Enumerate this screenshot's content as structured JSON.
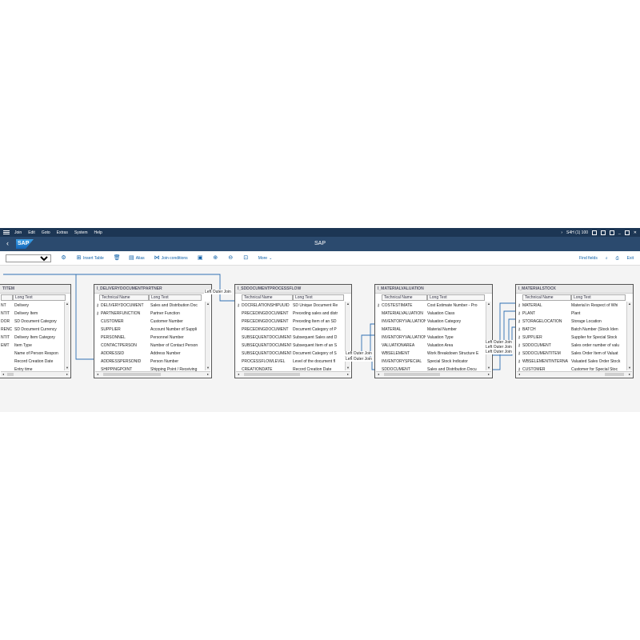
{
  "menubar": {
    "items": [
      "Join",
      "Edit",
      "Goto",
      "Extras",
      "System",
      "Help"
    ],
    "system_info": "S4H (1) 100"
  },
  "shell": {
    "logo": "SAP",
    "title": "SAP"
  },
  "toolbar": {
    "insert_table": "Insert Table",
    "alias": "Alias",
    "join_conditions": "Join conditions",
    "more": "More",
    "find_fields": "Find fields",
    "exit": "Exit"
  },
  "columns": {
    "technical_name": "Technical Name",
    "long_text": "Long Text"
  },
  "tables": [
    {
      "name": "TITEM",
      "rows": [
        {
          "key": false,
          "tech": "NT",
          "text": "Delivery"
        },
        {
          "key": false,
          "tech": "NTIT",
          "text": "Delivery Item"
        },
        {
          "key": false,
          "tech": "DOR",
          "text": "SD Document Category"
        },
        {
          "key": false,
          "tech": "RENC",
          "text": "SD Document Currency"
        },
        {
          "key": false,
          "tech": "NTIT",
          "text": "Delivery Item Category"
        },
        {
          "key": false,
          "tech": "EMT",
          "text": "Item Type"
        },
        {
          "key": false,
          "tech": "",
          "text": "Name of Person Respon"
        },
        {
          "key": false,
          "tech": "",
          "text": "Record Creation Date"
        },
        {
          "key": false,
          "tech": "",
          "text": "Entry time"
        }
      ]
    },
    {
      "name": "I_DELIVERYDOCUMENTPARTNER",
      "rows": [
        {
          "key": true,
          "tech": "DELIVERYDOCUMENT",
          "text": "Sales and Distribution Doc"
        },
        {
          "key": true,
          "tech": "PARTNERFUNCTION",
          "text": "Partner Function"
        },
        {
          "key": false,
          "tech": "CUSTOMER",
          "text": "Customer Number"
        },
        {
          "key": false,
          "tech": "SUPPLIER",
          "text": "Account Number of Suppli"
        },
        {
          "key": false,
          "tech": "PERSONNEL",
          "text": "Personnel Number"
        },
        {
          "key": false,
          "tech": "CONTACTPERSON",
          "text": "Number of Contact Person"
        },
        {
          "key": false,
          "tech": "ADDRESSID",
          "text": "Address Number"
        },
        {
          "key": false,
          "tech": "ADDRESSPERSONID",
          "text": "Person Number"
        },
        {
          "key": false,
          "tech": "SHIPPINGPOINT",
          "text": "Shipping Point / Receiving"
        }
      ]
    },
    {
      "name": "I_SDDOCUMENTPROCESSFLOW",
      "rows": [
        {
          "key": true,
          "tech": "DOCRELATIONSHIPUUID",
          "text": "SD Unique Document Re"
        },
        {
          "key": false,
          "tech": "PRECEDINGDOCUMENT",
          "text": "Preceding sales and distr"
        },
        {
          "key": false,
          "tech": "PRECEDINGDOCUMENT",
          "text": "Preceding Item of an SD"
        },
        {
          "key": false,
          "tech": "PRECEDINGDOCUMENT",
          "text": "Document Category of P"
        },
        {
          "key": false,
          "tech": "SUBSEQUENTDOCUMENT",
          "text": "Subsequent Sales and D"
        },
        {
          "key": false,
          "tech": "SUBSEQUENTDOCUMENT",
          "text": "Subsequent Item of an S"
        },
        {
          "key": false,
          "tech": "SUBSEQUENTDOCUMENT",
          "text": "Document Category of S"
        },
        {
          "key": false,
          "tech": "PROCESSFLOWLEVEL",
          "text": "Level of the document fl"
        },
        {
          "key": false,
          "tech": "CREATIONDATE",
          "text": "Record Creation Date"
        }
      ]
    },
    {
      "name": "I_MATERIALVALUATION",
      "rows": [
        {
          "key": true,
          "tech": "COSTESTIMATE",
          "text": "Cost Estimate Number - Pro"
        },
        {
          "key": false,
          "tech": "MATERIALVALUATION",
          "text": "Valuation Class"
        },
        {
          "key": false,
          "tech": "INVENTORYVALUATION",
          "text": "Valuation Category"
        },
        {
          "key": false,
          "tech": "MATERIAL",
          "text": "Material Number"
        },
        {
          "key": false,
          "tech": "INVENTORYVALUATION",
          "text": "Valuation Type"
        },
        {
          "key": false,
          "tech": "VALUATIONAREA",
          "text": "Valuation Area"
        },
        {
          "key": false,
          "tech": "WBSELEMENT",
          "text": "Work Breakdown Structure E"
        },
        {
          "key": false,
          "tech": "INVENTORYSPECIAL",
          "text": "Special Stock Indicator"
        },
        {
          "key": false,
          "tech": "SDDOCUMENT",
          "text": "Sales and Distribution Docu"
        }
      ]
    },
    {
      "name": "I_MATERIALSTOCK",
      "rows": [
        {
          "key": true,
          "tech": "MATERIAL",
          "text": "Material in Respect of Whi"
        },
        {
          "key": true,
          "tech": "PLANT",
          "text": "Plant"
        },
        {
          "key": true,
          "tech": "STORAGELOCATION",
          "text": "Storage Location"
        },
        {
          "key": true,
          "tech": "BATCH",
          "text": "Batch Number (Stock Iden"
        },
        {
          "key": true,
          "tech": "SUPPLIER",
          "text": "Supplier for Special Stock"
        },
        {
          "key": true,
          "tech": "SDDOCUMENT",
          "text": "Sales order number of valu"
        },
        {
          "key": true,
          "tech": "SDDOCUMENTITEM",
          "text": "Sales Order Item of Valuat"
        },
        {
          "key": true,
          "tech": "WBSELEMENTINTERNA",
          "text": "Valuated Sales Order Stock"
        },
        {
          "key": true,
          "tech": "CUSTOMER",
          "text": "Customer for Special Stoc"
        }
      ]
    }
  ],
  "joins": {
    "j1": "Left Outer Join",
    "j2": "Left Outer Join",
    "j3": "Left Outer Join",
    "j4": "Left Outer Join",
    "j5": "Left Outer Join",
    "j6": "Left Outer Join"
  }
}
